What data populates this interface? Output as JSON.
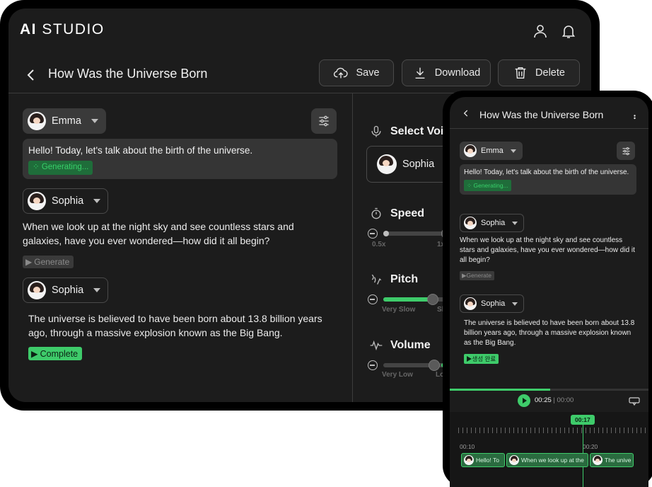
{
  "tablet": {
    "logo_prefix": "AI",
    "logo_suffix": " STUDIO",
    "page_title": "How Was the Universe Born",
    "actions": {
      "save": "Save",
      "download": "Download",
      "delete": "Delete"
    },
    "blocks": [
      {
        "speaker": "Emma",
        "text": "Hello! Today, let's talk about the birth of the universe.",
        "status": "Generating..."
      },
      {
        "speaker": "Sophia",
        "text": "When we look up at the night sky and see countless stars and galaxies, have you ever wondered—how did it all begin?",
        "status": "Generate"
      },
      {
        "speaker": "Sophia",
        "text": "The universe is believed to have been born about 13.8 billion years ago, through a massive explosion known as the Big Bang.",
        "status": "Complete"
      }
    ],
    "panel": {
      "select_voice": "Select Voi",
      "voice_name": "Sophia",
      "speed": {
        "label": "Speed",
        "min_label": "0.5x",
        "next_label": "1x",
        "value_fraction": 0.0
      },
      "pitch": {
        "label": "Pitch",
        "min_label": "Very Slow",
        "next_label": "Sl",
        "value_fraction": 0.85
      },
      "volume": {
        "label": "Volume",
        "min_label": "Very Low",
        "next_label": "Lo",
        "value_fraction": 0.5
      }
    }
  },
  "phone": {
    "page_title": "How Was the Universe Born",
    "blocks": [
      {
        "speaker": "Emma",
        "text": "Hello! Today, let's talk about the birth of the universe.",
        "status": "Generating..."
      },
      {
        "speaker": "Sophia",
        "text": "When we look up at the night sky and see countless stars and galaxies, have you ever wondered—how did it all begin?",
        "status": "Generate"
      },
      {
        "speaker": "Sophia",
        "text": "The universe is believed to have been born about 13.8 billion years ago, through a massive explosion known as the Big Bang.",
        "status": "생성 완료"
      }
    ],
    "player": {
      "current": "00:25",
      "separator": " | ",
      "total": "00:00",
      "progress_fraction": 0.5
    },
    "timeline": {
      "playhead": "00:17",
      "labels": [
        "00:10",
        "00:20"
      ],
      "clips": [
        "Hello! To",
        "When we look up at the",
        "The unive"
      ]
    }
  },
  "colors": {
    "accent": "#3ecb6a",
    "background": "#1c1c1c",
    "frame": "#000000"
  }
}
